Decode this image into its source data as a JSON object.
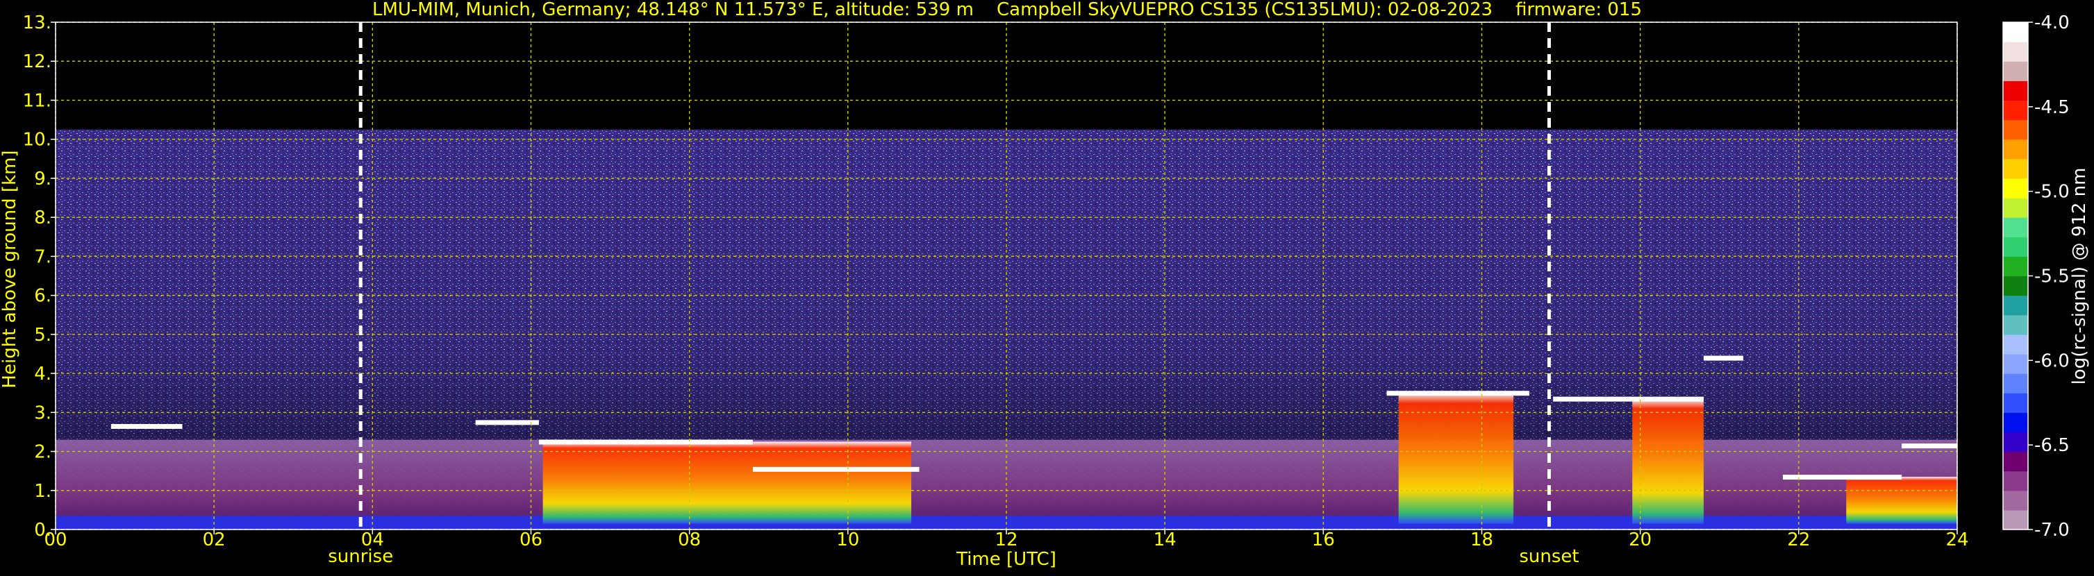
{
  "chart_data": {
    "type": "heatmap",
    "title": "LMU-MIM, Munich, Germany; 48.148° N 11.573° E, altitude: 539 m    Campbell SkyVUEPRO CS135 (CS135LMU): 02-08-2023    firmware: 015",
    "xlabel": "Time [UTC]",
    "ylabel": "Height above ground [km]",
    "xlim": [
      0,
      24
    ],
    "ylim": [
      0,
      13
    ],
    "x_ticks": [
      "00",
      "02",
      "04",
      "06",
      "08",
      "10",
      "12",
      "14",
      "16",
      "18",
      "20",
      "22",
      "24"
    ],
    "y_ticks": [
      "0.",
      "1.",
      "2.",
      "3.",
      "4.",
      "5.",
      "6.",
      "7.",
      "8.",
      "9.",
      "10.",
      "11.",
      "12.",
      "13."
    ],
    "grid": true,
    "annotations": [
      {
        "label": "sunrise",
        "x": 3.85
      },
      {
        "label": "sunset",
        "x": 18.85
      }
    ],
    "colorbar": {
      "label": "log(rc-signal) @ 912 nm",
      "range": [
        -7.0,
        -4.0
      ],
      "ticks": [
        "-4.0",
        "-4.5",
        "-5.0",
        "-5.5",
        "-6.0",
        "-6.5",
        "-7.0"
      ]
    },
    "signal_top_km": 10.25,
    "cloud_layers": [
      {
        "start": 0.7,
        "end": 1.6,
        "height_km": 2.65
      },
      {
        "start": 5.3,
        "end": 6.1,
        "height_km": 2.75
      },
      {
        "start": 6.1,
        "end": 8.8,
        "height_km": 2.25
      },
      {
        "start": 8.8,
        "end": 10.9,
        "height_km": 1.55
      },
      {
        "start": 16.8,
        "end": 18.6,
        "height_km": 3.5
      },
      {
        "start": 18.9,
        "end": 20.8,
        "height_km": 3.35
      },
      {
        "start": 20.8,
        "end": 21.3,
        "height_km": 4.4
      },
      {
        "start": 21.8,
        "end": 23.3,
        "height_km": 1.35
      },
      {
        "start": 23.3,
        "end": 24.0,
        "height_km": 2.15
      }
    ],
    "precip_shafts": [
      {
        "start": 6.15,
        "end": 10.8
      },
      {
        "start": 16.95,
        "end": 18.4
      },
      {
        "start": 19.9,
        "end": 20.8
      },
      {
        "start": 22.6,
        "end": 24.0
      }
    ]
  },
  "colors": {
    "text": "#ffff00",
    "grid": "#cccc00",
    "background": "#000000",
    "annotation_line": "#ffffff",
    "colorbar_stops": [
      "#b89ab8",
      "#a06aa0",
      "#8a3a8a",
      "#700070",
      "#3300cc",
      "#0010ee",
      "#3050ff",
      "#5f83ff",
      "#8aa6ff",
      "#a9c0ff",
      "#60c0c0",
      "#20a0a0",
      "#108010",
      "#20b020",
      "#30d070",
      "#50e090",
      "#c0f030",
      "#ffff00",
      "#ffd000",
      "#ffa000",
      "#ff6000",
      "#ff2000",
      "#ee0000",
      "#d0b0b0",
      "#f0e0e0",
      "#ffffff"
    ]
  }
}
